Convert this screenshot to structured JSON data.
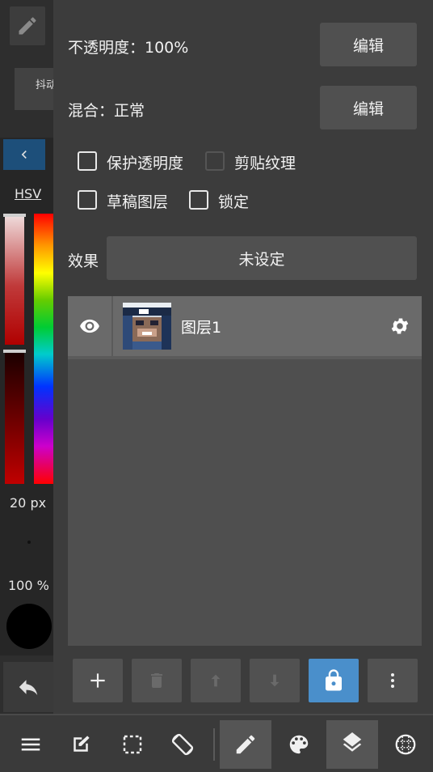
{
  "left_toolbar": {
    "brush_chip_label": "抖动",
    "color_mode_label": "HSV",
    "brush_size_label": "20 px",
    "opacity_label": "100 %",
    "current_color": "#000000"
  },
  "layer_panel": {
    "opacity_row": {
      "label": "不透明度：100%",
      "button": "编辑"
    },
    "blend_row": {
      "label": "混合：正常",
      "button": "编辑"
    },
    "checkboxes": [
      {
        "label": "保护透明度",
        "checked": false,
        "enabled": true
      },
      {
        "label": "剪贴纹理",
        "checked": false,
        "enabled": false
      },
      {
        "label": "草稿图层",
        "checked": false,
        "enabled": true
      },
      {
        "label": "锁定",
        "checked": false,
        "enabled": true
      }
    ],
    "effect_row": {
      "label": "效果",
      "button": "未设定"
    },
    "layers": [
      {
        "name": "图层1",
        "visible": true
      }
    ],
    "actions": [
      "add-layer",
      "delete-layer",
      "move-up",
      "move-down",
      "lock-layer",
      "more-options"
    ]
  },
  "bottom_bar": {
    "items": [
      "menu",
      "edit",
      "selection",
      "rotate-canvas",
      "pen-tool",
      "palette",
      "layers",
      "grid"
    ],
    "active": [
      "pen-tool",
      "layers"
    ]
  },
  "colors": {
    "accent_blue": "#4a8fcb",
    "panel_bg": "#3c3c3c",
    "button_bg": "#505050"
  }
}
